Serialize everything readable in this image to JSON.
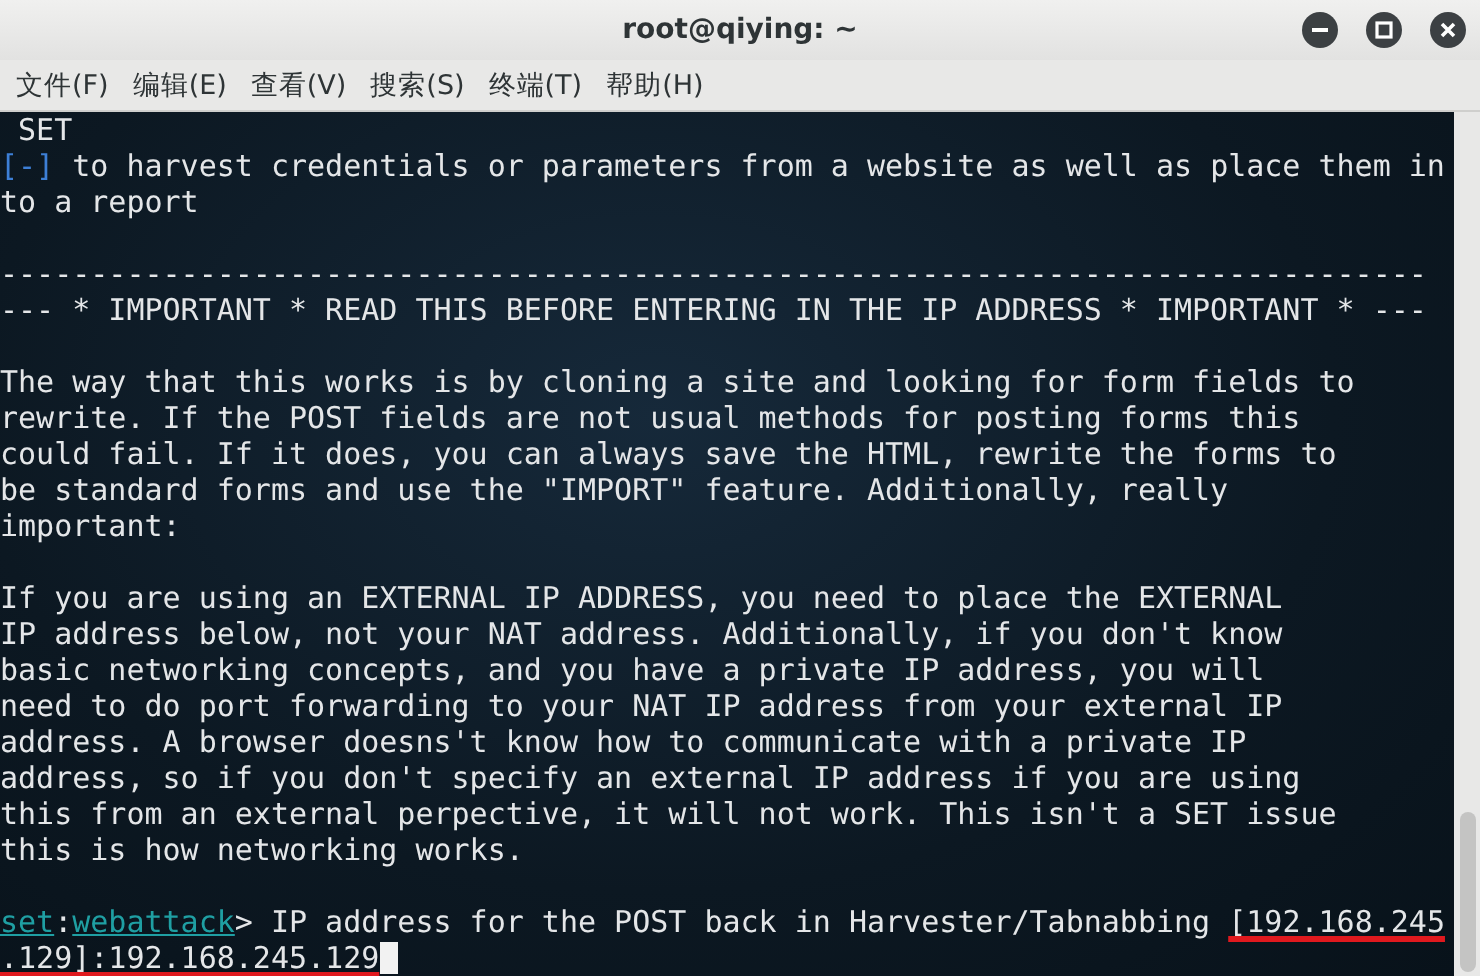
{
  "window": {
    "title": "root@qiying: ~"
  },
  "menu": [
    "文件(F)",
    "编辑(E)",
    "查看(V)",
    "搜索(S)",
    "终端(T)",
    "帮助(H)"
  ],
  "terminal": {
    "lines": [
      {
        "kind": "text",
        "segments": [
          {
            "kind": "plain",
            "text": " SET"
          }
        ]
      },
      {
        "kind": "text",
        "segments": [
          {
            "kind": "marker",
            "text": "[-]"
          },
          {
            "kind": "plain",
            "text": " to harvest credentials or parameters from a website as well as place them in"
          }
        ]
      },
      {
        "kind": "text",
        "segments": [
          {
            "kind": "plain",
            "text": "to a report"
          }
        ]
      },
      {
        "kind": "blank"
      },
      {
        "kind": "text",
        "segments": [
          {
            "kind": "plain",
            "text": "-------------------------------------------------------------------------------"
          }
        ]
      },
      {
        "kind": "text",
        "segments": [
          {
            "kind": "plain",
            "text": "--- * IMPORTANT * READ THIS BEFORE ENTERING IN THE IP ADDRESS * IMPORTANT * ---"
          }
        ]
      },
      {
        "kind": "blank"
      },
      {
        "kind": "text",
        "segments": [
          {
            "kind": "plain",
            "text": "The way that this works is by cloning a site and looking for form fields to"
          }
        ]
      },
      {
        "kind": "text",
        "segments": [
          {
            "kind": "plain",
            "text": "rewrite. If the POST fields are not usual methods for posting forms this"
          }
        ]
      },
      {
        "kind": "text",
        "segments": [
          {
            "kind": "plain",
            "text": "could fail. If it does, you can always save the HTML, rewrite the forms to"
          }
        ]
      },
      {
        "kind": "text",
        "segments": [
          {
            "kind": "plain",
            "text": "be standard forms and use the \"IMPORT\" feature. Additionally, really"
          }
        ]
      },
      {
        "kind": "text",
        "segments": [
          {
            "kind": "plain",
            "text": "important:"
          }
        ]
      },
      {
        "kind": "blank"
      },
      {
        "kind": "text",
        "segments": [
          {
            "kind": "plain",
            "text": "If you are using an EXTERNAL IP ADDRESS, you need to place the EXTERNAL"
          }
        ]
      },
      {
        "kind": "text",
        "segments": [
          {
            "kind": "plain",
            "text": "IP address below, not your NAT address. Additionally, if you don't know"
          }
        ]
      },
      {
        "kind": "text",
        "segments": [
          {
            "kind": "plain",
            "text": "basic networking concepts, and you have a private IP address, you will"
          }
        ]
      },
      {
        "kind": "text",
        "segments": [
          {
            "kind": "plain",
            "text": "need to do port forwarding to your NAT IP address from your external IP"
          }
        ]
      },
      {
        "kind": "text",
        "segments": [
          {
            "kind": "plain",
            "text": "address. A browser doesns't know how to communicate with a private IP"
          }
        ]
      },
      {
        "kind": "text",
        "segments": [
          {
            "kind": "plain",
            "text": "address, so if you don't specify an external IP address if you are using"
          }
        ]
      },
      {
        "kind": "text",
        "segments": [
          {
            "kind": "plain",
            "text": "this from an external perpective, it will not work. This isn't a SET issue"
          }
        ]
      },
      {
        "kind": "text",
        "segments": [
          {
            "kind": "plain",
            "text": "this is how networking works."
          }
        ]
      },
      {
        "kind": "blank"
      },
      {
        "kind": "text",
        "segments": [
          {
            "kind": "prompt",
            "text": "set"
          },
          {
            "kind": "plain",
            "text": ":"
          },
          {
            "kind": "prompt",
            "text": "webattack"
          },
          {
            "kind": "plain",
            "text": "> IP address for the POST back in Harvester/Tabnabbing "
          },
          {
            "kind": "highlight",
            "text": "[192.168.245"
          }
        ]
      },
      {
        "kind": "text",
        "segments": [
          {
            "kind": "highlight",
            "text": ".129]:192.168.245.129"
          },
          {
            "kind": "cursor"
          }
        ]
      }
    ]
  }
}
